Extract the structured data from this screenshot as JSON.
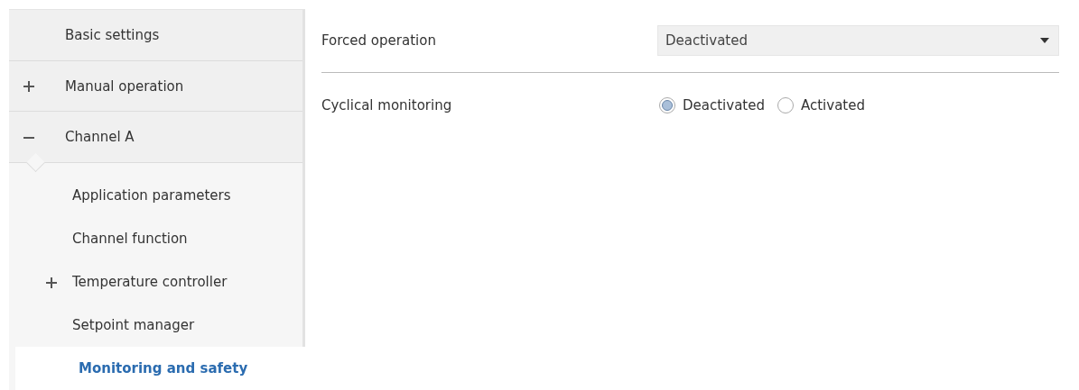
{
  "sidebar": {
    "items": [
      {
        "label": "Basic settings",
        "selected": false
      },
      {
        "label": "Manual operation",
        "selected": false,
        "expanded": false
      },
      {
        "label": "Channel A",
        "selected": false,
        "expanded": true,
        "children": [
          {
            "label": "Application parameters",
            "selected": false
          },
          {
            "label": "Channel function",
            "selected": false
          },
          {
            "label": "Temperature controller",
            "selected": false,
            "expanded": false
          },
          {
            "label": "Setpoint manager",
            "selected": false
          },
          {
            "label": "Monitoring and safety",
            "selected": true
          }
        ]
      }
    ]
  },
  "parameters": [
    {
      "kind": "dropdown",
      "label": "Forced operation",
      "value": "Deactivated"
    },
    {
      "kind": "radio",
      "label": "Cyclical monitoring",
      "options": [
        {
          "label": "Deactivated",
          "selected": true
        },
        {
          "label": "Activated",
          "selected": false
        }
      ]
    }
  ]
}
